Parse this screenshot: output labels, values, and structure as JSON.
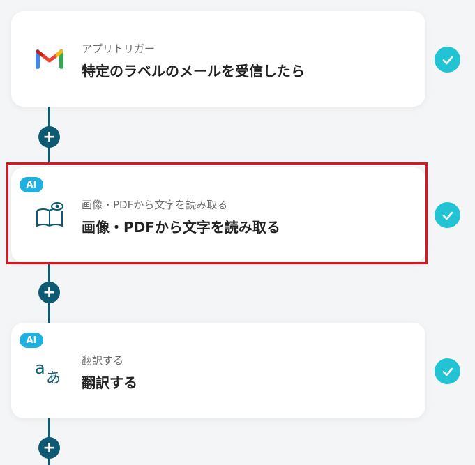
{
  "flow": {
    "steps": [
      {
        "sublabel": "アプリトリガー",
        "title": "特定のラベルのメールを受信したら",
        "icon": "gmail-icon",
        "ai": false,
        "status": "complete"
      },
      {
        "sublabel": "画像・PDFから文字を読み取る",
        "title": "画像・PDFから文字を読み取る",
        "icon": "book-eye-icon",
        "ai": true,
        "status": "complete"
      },
      {
        "sublabel": "翻訳する",
        "title": "翻訳する",
        "icon": "translate-icon",
        "ai": true,
        "status": "complete"
      }
    ],
    "ai_badge_label": "AI",
    "add_button_symbol": "+"
  },
  "colors": {
    "connector": "#0e5a73",
    "check": "#22c3d2",
    "ai_badge": "#1fb0e0",
    "highlight": "#e0141e"
  }
}
